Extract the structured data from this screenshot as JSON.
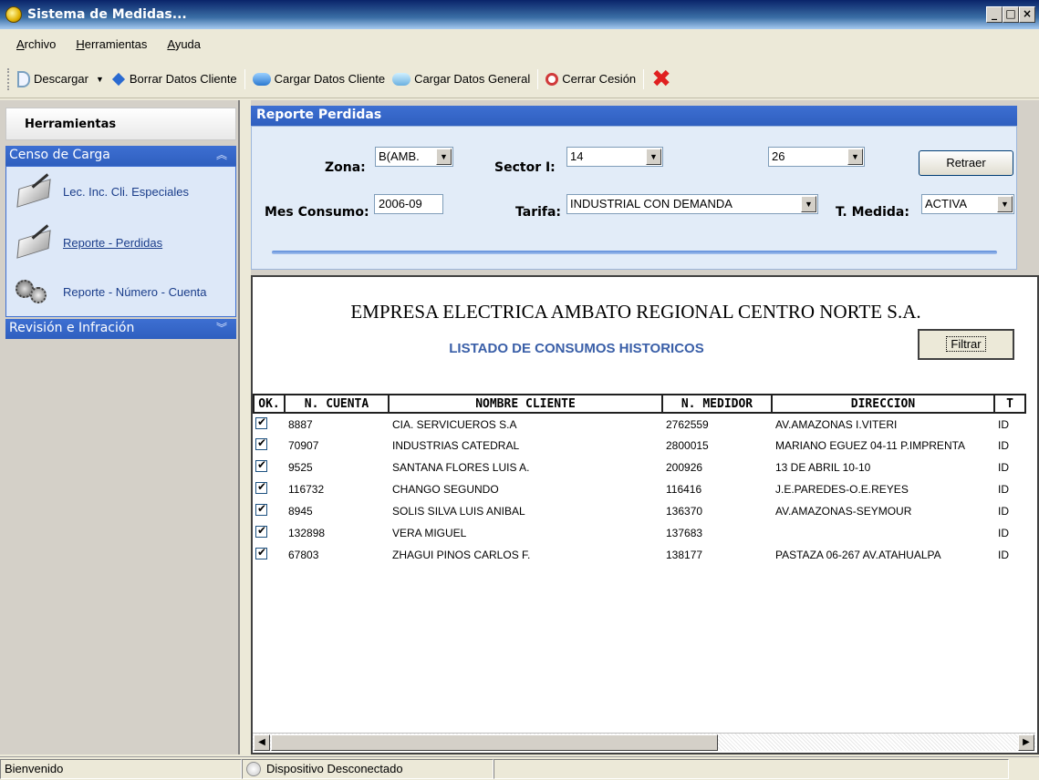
{
  "window": {
    "title": "Sistema de Medidas...",
    "controls": [
      "_",
      "□",
      "×"
    ]
  },
  "menu": [
    "Archivo",
    "Herramientas",
    "Ayuda"
  ],
  "toolbar": {
    "descargar": "Descargar",
    "borrar": "Borrar Datos Cliente",
    "cargar_cliente": "Cargar Datos Cliente",
    "cargar_general": "Cargar Datos General",
    "cerrar": "Cerrar Cesión"
  },
  "sidebar": {
    "header": "Herramientas",
    "group1": "Censo de Carga",
    "items": [
      "Lec. Inc. Cli. Especiales",
      "Reporte - Perdidas",
      "Reporte - Número - Cuenta"
    ],
    "group2": "Revisión e Infración"
  },
  "report": {
    "title": "Reporte Perdidas",
    "zona_label": "Zona:",
    "zona_value": "B(AMB.",
    "sector_label": "Sector I:",
    "sector_value": "14",
    "sector2_value": "26",
    "retraer": "Retraer",
    "mes_label": "Mes Consumo:",
    "mes_value": "2006-09",
    "tarifa_label": "Tarifa:",
    "tarifa_value": "INDUSTRIAL CON DEMANDA",
    "medida_label": "T. Medida:",
    "medida_value": "ACTIVA"
  },
  "sheet": {
    "company": "EMPRESA ELECTRICA AMBATO REGIONAL CENTRO NORTE S.A.",
    "listado": "LISTADO DE CONSUMOS HISTORICOS",
    "filtrar": "Filtrar",
    "columns": [
      "OK.",
      "N. CUENTA",
      "NOMBRE CLIENTE",
      "N. MEDIDOR",
      "DIRECCION",
      "T"
    ],
    "rows": [
      {
        "cuenta": "8887",
        "nombre": "CIA. SERVICUEROS S.A",
        "medidor": "2762559",
        "direccion": "AV.AMAZONAS I.VITERI",
        "t": "ID"
      },
      {
        "cuenta": "70907",
        "nombre": "INDUSTRIAS CATEDRAL",
        "medidor": "2800015",
        "direccion": "MARIANO EGUEZ 04-11 P.IMPRENTA",
        "t": "ID"
      },
      {
        "cuenta": "9525",
        "nombre": "SANTANA FLORES LUIS A.",
        "medidor": "200926",
        "direccion": "13 DE ABRIL 10-10",
        "t": "ID"
      },
      {
        "cuenta": "116732",
        "nombre": "CHANGO SEGUNDO",
        "medidor": "116416",
        "direccion": "J.E.PAREDES-O.E.REYES",
        "t": "ID"
      },
      {
        "cuenta": "8945",
        "nombre": "SOLIS SILVA LUIS ANIBAL",
        "medidor": "136370",
        "direccion": "AV.AMAZONAS-SEYMOUR",
        "t": "ID"
      },
      {
        "cuenta": "132898",
        "nombre": "VERA MIGUEL",
        "medidor": "137683",
        "direccion": "",
        "t": "ID"
      },
      {
        "cuenta": "67803",
        "nombre": "ZHAGUI PINOS CARLOS F.",
        "medidor": "138177",
        "direccion": "PASTAZA 06-267 AV.ATAHUALPA",
        "t": "ID"
      }
    ]
  },
  "status": {
    "left": "Bienvenido",
    "device": "Dispositivo Desconectado"
  },
  "icons": {
    "app": "lightbulb-icon",
    "descargar": "download-icon",
    "borrar": "erase-icon",
    "cargar_cliente": "cloud-icon",
    "cargar_general": "cloud-icon",
    "cerrar": "logout-icon",
    "close_app": "red-x-icon"
  }
}
